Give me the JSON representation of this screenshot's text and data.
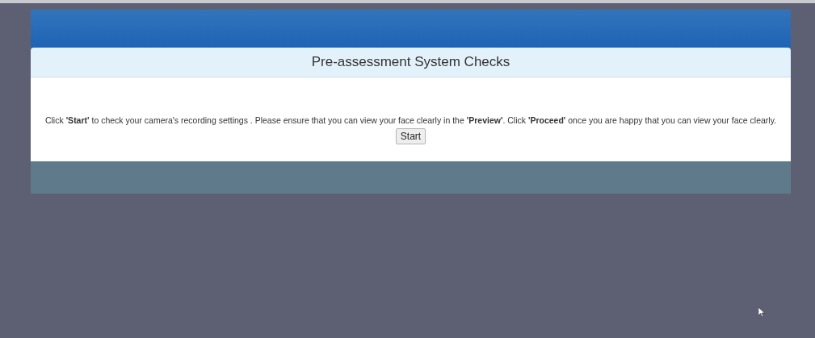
{
  "dialog": {
    "title": "Pre-assessment System Checks",
    "instructions": "Click **'Start'** to check your camera's recording settings . Please ensure that you can view your face clearly in the **'Preview'**. Click **'Proceed'** once you are happy that you can view your face clearly.",
    "button": {
      "label": "Start"
    }
  }
}
